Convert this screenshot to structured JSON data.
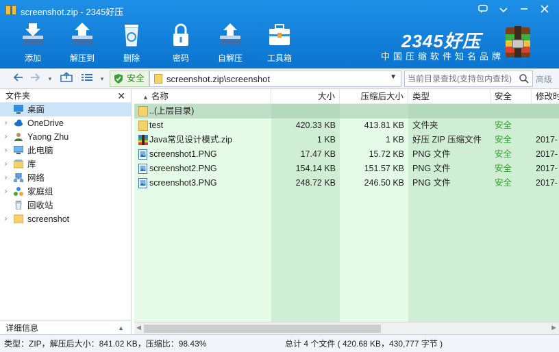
{
  "window": {
    "title": "screenshot.zip - 2345好压"
  },
  "toolbar": {
    "buttons": [
      {
        "label": "添加",
        "icon": "add-archive-icon"
      },
      {
        "label": "解压到",
        "icon": "extract-to-icon"
      },
      {
        "label": "删除",
        "icon": "recycle-bin-icon"
      },
      {
        "label": "密码",
        "icon": "lock-icon"
      },
      {
        "label": "自解压",
        "icon": "self-extract-icon"
      },
      {
        "label": "工具箱",
        "icon": "toolbox-icon"
      }
    ]
  },
  "brand": {
    "name": "2345好压",
    "slogan": "中国压缩软件知名品牌"
  },
  "addressbar": {
    "safe_label": "安全",
    "path": "screenshot.zip\\screenshot",
    "search_placeholder": "当前目录查找(支持包内查找)",
    "advanced_label": "高级"
  },
  "folders_panel": {
    "title": "文件夹",
    "items": [
      {
        "label": "桌面",
        "icon": "desktop-icon",
        "selected": true,
        "expandable": false
      },
      {
        "label": "OneDrive",
        "icon": "onedrive-icon",
        "selected": false,
        "expandable": true
      },
      {
        "label": "Yaong Zhu",
        "icon": "user-icon",
        "selected": false,
        "expandable": true
      },
      {
        "label": "此电脑",
        "icon": "computer-icon",
        "selected": false,
        "expandable": true
      },
      {
        "label": "库",
        "icon": "library-icon",
        "selected": false,
        "expandable": true
      },
      {
        "label": "网络",
        "icon": "network-icon",
        "selected": false,
        "expandable": true
      },
      {
        "label": "家庭组",
        "icon": "homegroup-icon",
        "selected": false,
        "expandable": true
      },
      {
        "label": "回收站",
        "icon": "recycle-bin-icon",
        "selected": false,
        "expandable": false
      },
      {
        "label": "screenshot",
        "icon": "folder-icon",
        "selected": false,
        "expandable": true
      }
    ],
    "details_label": "详细信息"
  },
  "filelist": {
    "columns": [
      "名称",
      "大小",
      "压缩后大小",
      "类型",
      "安全",
      "修改时"
    ],
    "parent_row": "..(上层目录)",
    "rows": [
      {
        "name": "test",
        "size": "420.33 KB",
        "packed": "413.81 KB",
        "type": "文件夹",
        "safety": "安全",
        "modified": "",
        "icon": "folder-icon"
      },
      {
        "name": "Java常见设计模式.zip",
        "size": "1 KB",
        "packed": "1 KB",
        "type": "好压 ZIP 压缩文件",
        "safety": "安全",
        "modified": "2017-",
        "icon": "zip-archive-icon"
      },
      {
        "name": "screenshot1.PNG",
        "size": "17.47 KB",
        "packed": "15.72 KB",
        "type": "PNG 文件",
        "safety": "安全",
        "modified": "2017-",
        "icon": "image-file-icon"
      },
      {
        "name": "screenshot2.PNG",
        "size": "154.14 KB",
        "packed": "151.57 KB",
        "type": "PNG 文件",
        "safety": "安全",
        "modified": "2017-",
        "icon": "image-file-icon"
      },
      {
        "name": "screenshot3.PNG",
        "size": "248.72 KB",
        "packed": "246.50 KB",
        "type": "PNG 文件",
        "safety": "安全",
        "modified": "2017-",
        "icon": "image-file-icon"
      }
    ]
  },
  "statusbar": {
    "left": "类型：ZIP，解压后大小：841.02 KB，压缩比：98.43%",
    "right": "总计 4 个文件 ( 420.68 KB，430,777 字节 )"
  },
  "colors": {
    "titlebar": "#0b74cf",
    "safe": "#2fa32b",
    "list_bg": "#e5fbe8"
  }
}
